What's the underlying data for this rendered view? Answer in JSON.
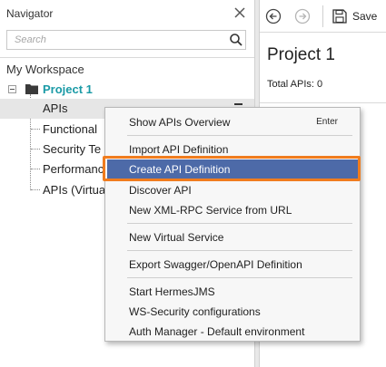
{
  "navigator": {
    "title": "Navigator",
    "search_placeholder": "Search",
    "workspace_label": "My Workspace",
    "tree": {
      "project": "Project 1",
      "items": [
        "APIs",
        "Functional",
        "Security Te",
        "Performanc",
        "APIs (Virtua"
      ]
    }
  },
  "toolbar": {
    "back_icon": "back-arrow-icon",
    "forward_icon": "forward-arrow-icon",
    "save_label": "Save"
  },
  "project_panel": {
    "title": "Project 1",
    "total_apis": "Total APIs: 0"
  },
  "context_menu": {
    "items": [
      {
        "label": "Show APIs Overview",
        "shortcut": "Enter"
      },
      {
        "label": "Import API Definition"
      },
      {
        "label": "Create API Definition"
      },
      {
        "label": "Discover API"
      },
      {
        "label": "New XML-RPC Service from URL"
      },
      {
        "label": "New Virtual Service"
      },
      {
        "label": "Export Swagger/OpenAPI Definition"
      },
      {
        "label": "Start HermesJMS"
      },
      {
        "label": "WS-Security configurations"
      },
      {
        "label": "Auth Manager - Default environment"
      }
    ],
    "highlighted_index": 2
  },
  "colors": {
    "project_accent": "#1a9aa6",
    "menu_highlight": "#4d6aa8",
    "focus_ring": "#f07c1e"
  }
}
